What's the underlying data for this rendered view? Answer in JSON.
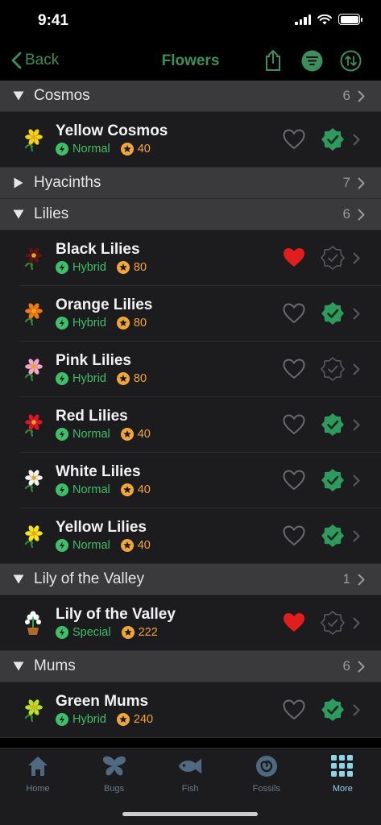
{
  "status": {
    "time": "9:41"
  },
  "nav": {
    "back_label": "Back",
    "title": "Flowers"
  },
  "colors": {
    "accent": "#3a8f5c",
    "normal": "#3fbf6a",
    "price": "#f2a53a",
    "heart_on": "#e11d1d",
    "tab_active": "#8fd3e6"
  },
  "sections": [
    {
      "name": "Cosmos",
      "count": "6",
      "expanded": true,
      "items": [
        {
          "title": "Yellow Cosmos",
          "kind": "Normal",
          "price": "40",
          "fav": false,
          "done": true,
          "color": "#f5d21a"
        }
      ]
    },
    {
      "name": "Hyacinths",
      "count": "7",
      "expanded": false,
      "items": []
    },
    {
      "name": "Lilies",
      "count": "6",
      "expanded": true,
      "items": [
        {
          "title": "Black Lilies",
          "kind": "Hybrid",
          "price": "80",
          "fav": true,
          "done": false,
          "color": "#5a1616"
        },
        {
          "title": "Orange Lilies",
          "kind": "Hybrid",
          "price": "80",
          "fav": false,
          "done": true,
          "color": "#f07a12"
        },
        {
          "title": "Pink Lilies",
          "kind": "Hybrid",
          "price": "80",
          "fav": false,
          "done": false,
          "color": "#f0a6c8"
        },
        {
          "title": "Red Lilies",
          "kind": "Normal",
          "price": "40",
          "fav": false,
          "done": true,
          "color": "#d8182a"
        },
        {
          "title": "White Lilies",
          "kind": "Normal",
          "price": "40",
          "fav": false,
          "done": true,
          "color": "#f4f4ee"
        },
        {
          "title": "Yellow Lilies",
          "kind": "Normal",
          "price": "40",
          "fav": false,
          "done": true,
          "color": "#f7e21c"
        }
      ]
    },
    {
      "name": "Lily of the Valley",
      "count": "1",
      "expanded": true,
      "items": [
        {
          "title": "Lily of the Valley",
          "kind": "Special",
          "price": "222",
          "fav": true,
          "done": false,
          "color": "#ffffff"
        }
      ]
    },
    {
      "name": "Mums",
      "count": "6",
      "expanded": true,
      "items": [
        {
          "title": "Green Mums",
          "kind": "Hybrid",
          "price": "240",
          "fav": false,
          "done": true,
          "color": "#b8e02a"
        }
      ]
    }
  ],
  "tabs": [
    {
      "label": "Home",
      "icon": "home-icon",
      "active": false
    },
    {
      "label": "Bugs",
      "icon": "butterfly-icon",
      "active": false
    },
    {
      "label": "Fish",
      "icon": "fish-icon",
      "active": false
    },
    {
      "label": "Fossils",
      "icon": "fossil-icon",
      "active": false
    },
    {
      "label": "More",
      "icon": "grid-icon",
      "active": true
    }
  ]
}
